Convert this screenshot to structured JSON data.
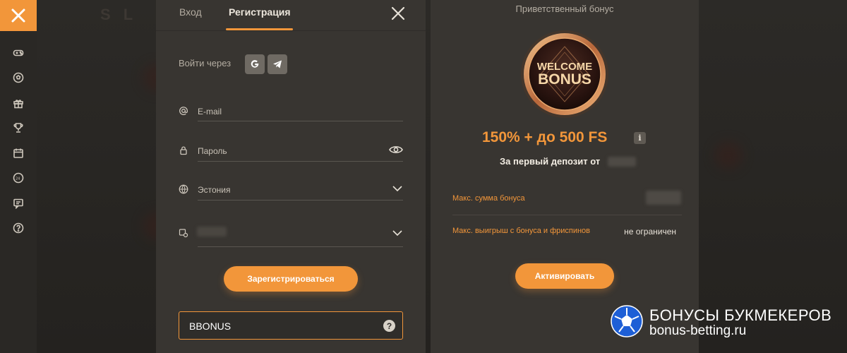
{
  "backdrop": {
    "logo_ghost": "S  L"
  },
  "sidebar": {
    "icons": [
      "close-icon",
      "gamepad-icon",
      "soccer-ball-icon",
      "gift-icon",
      "trophy-icon",
      "calendar-icon",
      "live-24-icon",
      "chat-icon",
      "help-circle-icon"
    ]
  },
  "register": {
    "tabs": {
      "login": "Вход",
      "register": "Регистрация"
    },
    "login_via": "Войти через",
    "fields": {
      "email_placeholder": "E-mail",
      "password_placeholder": "Пароль",
      "country_value": "Эстония"
    },
    "submit_label": "Зарегистрироваться",
    "promo_code": "BBONUS",
    "help_symbol": "?"
  },
  "bonus": {
    "title": "Приветственный бонус",
    "coin_line1": "WELCOME",
    "coin_line2": "BONUS",
    "amount": "150% + до 500 FS",
    "info_symbol": "i",
    "deposit_text": "За первый депозит от",
    "rows": [
      {
        "label": "Макс. сумма бонуса",
        "value": ""
      },
      {
        "label": "Макс. выигрыш с бонуса и фриспинов",
        "value": "не ограничен"
      }
    ],
    "activate_label": "Активировать"
  },
  "watermark": {
    "line1": "БОНУСЫ БУКМЕКЕРОВ",
    "line2": "bonus-betting.ru"
  },
  "colors": {
    "accent": "#f2963a",
    "panel": "#383531",
    "sidebar": "#2a2825"
  }
}
